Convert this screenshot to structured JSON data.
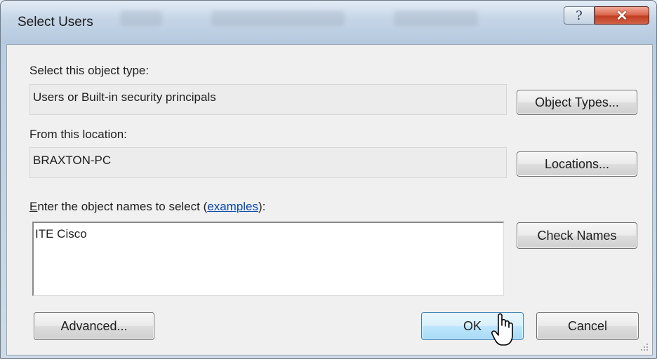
{
  "window": {
    "title": "Select Users"
  },
  "titlebar": {
    "help_glyph": "?",
    "close_glyph": "✕"
  },
  "object_type": {
    "label": "Select this object type:",
    "value": "Users or Built-in security principals",
    "button": "Object Types..."
  },
  "location": {
    "label": "From this location:",
    "value": "BRAXTON-PC",
    "button": "Locations..."
  },
  "names": {
    "label_first": "E",
    "label_rest": "nter the object names to select (",
    "link": "examples",
    "label_end": "):",
    "value": "ITE Cisco",
    "button": "Check Names"
  },
  "footer": {
    "advanced": "Advanced...",
    "ok": "OK",
    "cancel": "Cancel"
  },
  "icons": [
    "help-icon",
    "close-icon",
    "mouse-pointer-icon",
    "resize-grip-icon"
  ],
  "colors": {
    "link": "#0645ad",
    "close_button": "#c13f22",
    "default_button_border": "#3c7fb1"
  }
}
